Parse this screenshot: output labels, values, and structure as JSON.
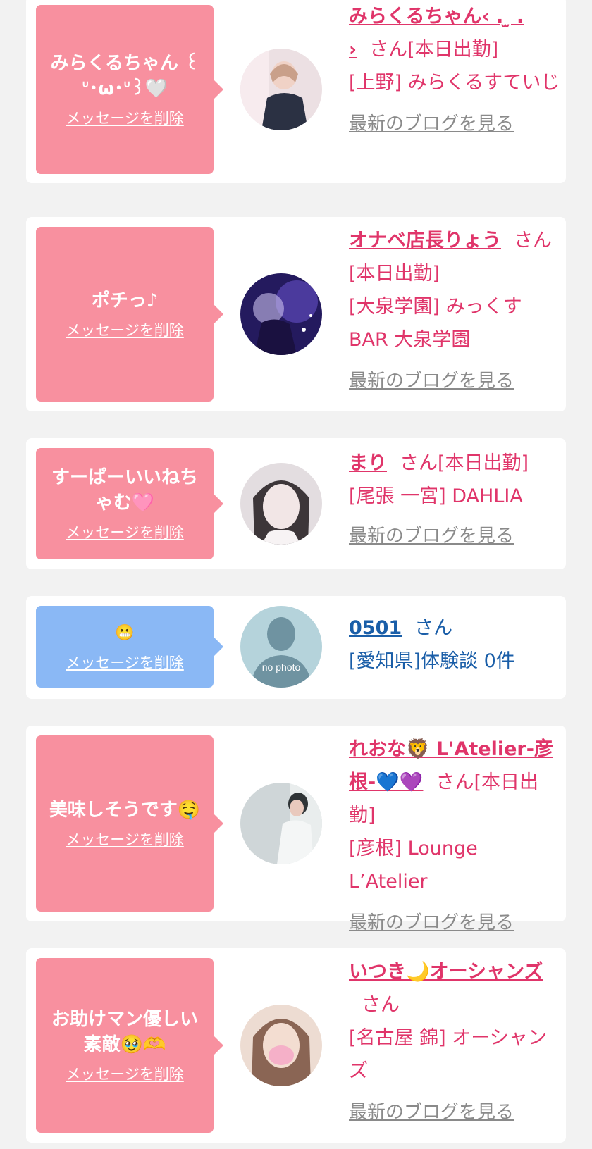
{
  "delete_label": "メッセージを削除",
  "blog_label": "最新のブログを見る",
  "items": [
    {
      "message": "みらくるちゃん ꒰ᐡ･ω･ᐡ꒱🤍",
      "name": "みらくるちゃん‹ . ̫ . ›",
      "suffix": "さん[本日出勤]",
      "shop": "[上野] みらくるすていじ",
      "avatar_colors": [
        "#e9d9dd",
        "#2b3143",
        "#f6e4e4"
      ]
    },
    {
      "message": "ポチっ♪",
      "name": "オナベ店長りょう",
      "suffix": "さん[本日出勤]",
      "shop": "[大泉学園] みっくすBAR 大泉学園",
      "avatar_colors": [
        "#3a2d8f",
        "#8b6fc9",
        "#1a1140"
      ]
    },
    {
      "message": "すーぱーいいねちゃむ🩷",
      "name": "まり",
      "suffix": "さん[本日出勤]",
      "shop": "[尾張 一宮] DAHLIA",
      "avatar_colors": [
        "#d8d3d6",
        "#4a4448",
        "#f1e8e9"
      ]
    },
    {
      "message": "😬",
      "name": "0501",
      "suffix": "さん",
      "shop": "[愛知県]体験談 0件",
      "avatar_text": "no photo",
      "avatar_colors": [
        "#a9c9d3",
        "#5f8594",
        "#c7dde3"
      ]
    },
    {
      "message": "美味しそうです🤤",
      "name": "れおな🦁 L'Atelier-彦根-💙💜",
      "suffix": "さん[本日出勤]",
      "shop": "[彦根] Lounge L’Atelier",
      "avatar_colors": [
        "#c9d0d2",
        "#eef1f1",
        "#2f3436"
      ]
    },
    {
      "message": "お助けマン優しい素敵🥹🫶",
      "name": "いつき🌙オーシャンズ",
      "suffix": "さん",
      "shop": "[名古屋 錦] オーシャンズ",
      "avatar_colors": [
        "#e8c9b8",
        "#7b5a49",
        "#f5b0c8"
      ]
    }
  ],
  "colors": {
    "pink_bubble": "#f8909f",
    "blue_bubble": "#8ab8f5",
    "name_pink": "#e0356a",
    "name_blue": "#1a5ea8"
  }
}
